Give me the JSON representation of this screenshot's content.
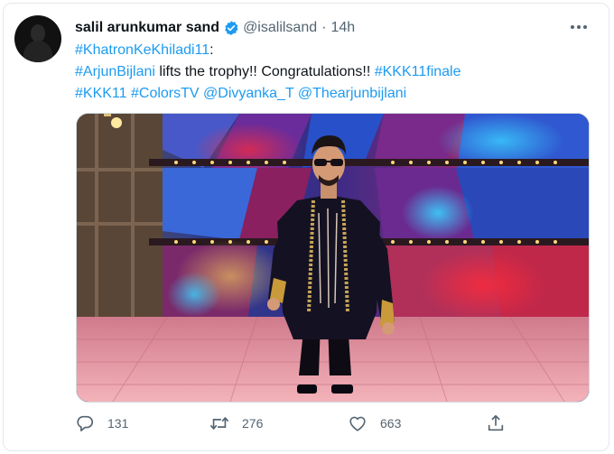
{
  "author": {
    "display_name": "salil arunkumar sand",
    "handle": "@isalilsand",
    "separator": "·",
    "time": "14h"
  },
  "tweet": {
    "line1": [
      "#KhatronKeKhiladi11",
      ":"
    ],
    "line2": [
      "#ArjunBijlani",
      " lifts the trophy!! Congratulations!! ",
      "#KKK11finale"
    ],
    "line3": [
      "#KKK11",
      " ",
      "#ColorsTV",
      " ",
      "@Divyanka_T",
      " ",
      "@Thearjunbijlani"
    ]
  },
  "actions": {
    "replies": "131",
    "retweets": "276",
    "likes": "663"
  },
  "icons": {
    "verified": "verified-badge-icon",
    "more": "more-options-icon",
    "reply": "reply-icon",
    "retweet": "retweet-icon",
    "like": "heart-icon",
    "share": "share-icon"
  },
  "colors": {
    "link": "#1d9bf0",
    "text": "#0f1419",
    "muted": "#536471",
    "border": "#e3e7ea"
  }
}
